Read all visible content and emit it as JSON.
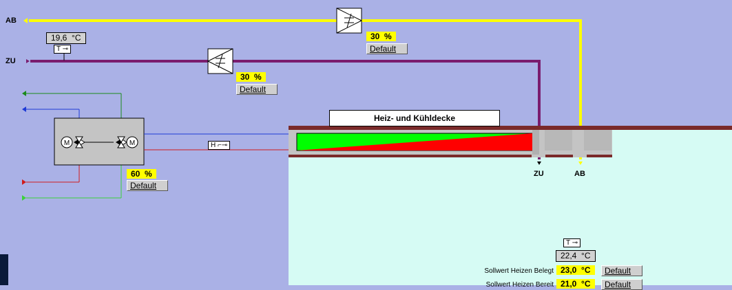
{
  "labels": {
    "ab": "AB",
    "zu": "ZU",
    "ab_bottom": "AB",
    "zu_bottom": "ZU"
  },
  "outdoor_temp": {
    "value": "19,6",
    "unit": "°C",
    "sensor": "T"
  },
  "damper_ab": {
    "value": "30",
    "unit": "%",
    "mode": "Default"
  },
  "damper_zu": {
    "value": "30",
    "unit": "%",
    "mode": "Default"
  },
  "valve": {
    "value": "60",
    "unit": "%",
    "mode": "Default",
    "switch": "H"
  },
  "ceiling": {
    "title": "Heiz- und Kühldecke"
  },
  "room": {
    "sensor": "T",
    "temp": "22,4",
    "temp_unit": "°C",
    "setpoints": [
      {
        "label": "Sollwert Heizen Belegt",
        "value": "23,0",
        "unit": "°C",
        "mode": "Default"
      },
      {
        "label": "Sollwert Heizen Bereit",
        "value": "21,0",
        "unit": "°C",
        "mode": "Default"
      }
    ]
  },
  "colors": {
    "background": "#aab1e6",
    "room": "#d6fbf4",
    "exhaust_line": "#ffff00",
    "supply_line": "#7a1c6e",
    "value_bg": "#ffff00"
  }
}
